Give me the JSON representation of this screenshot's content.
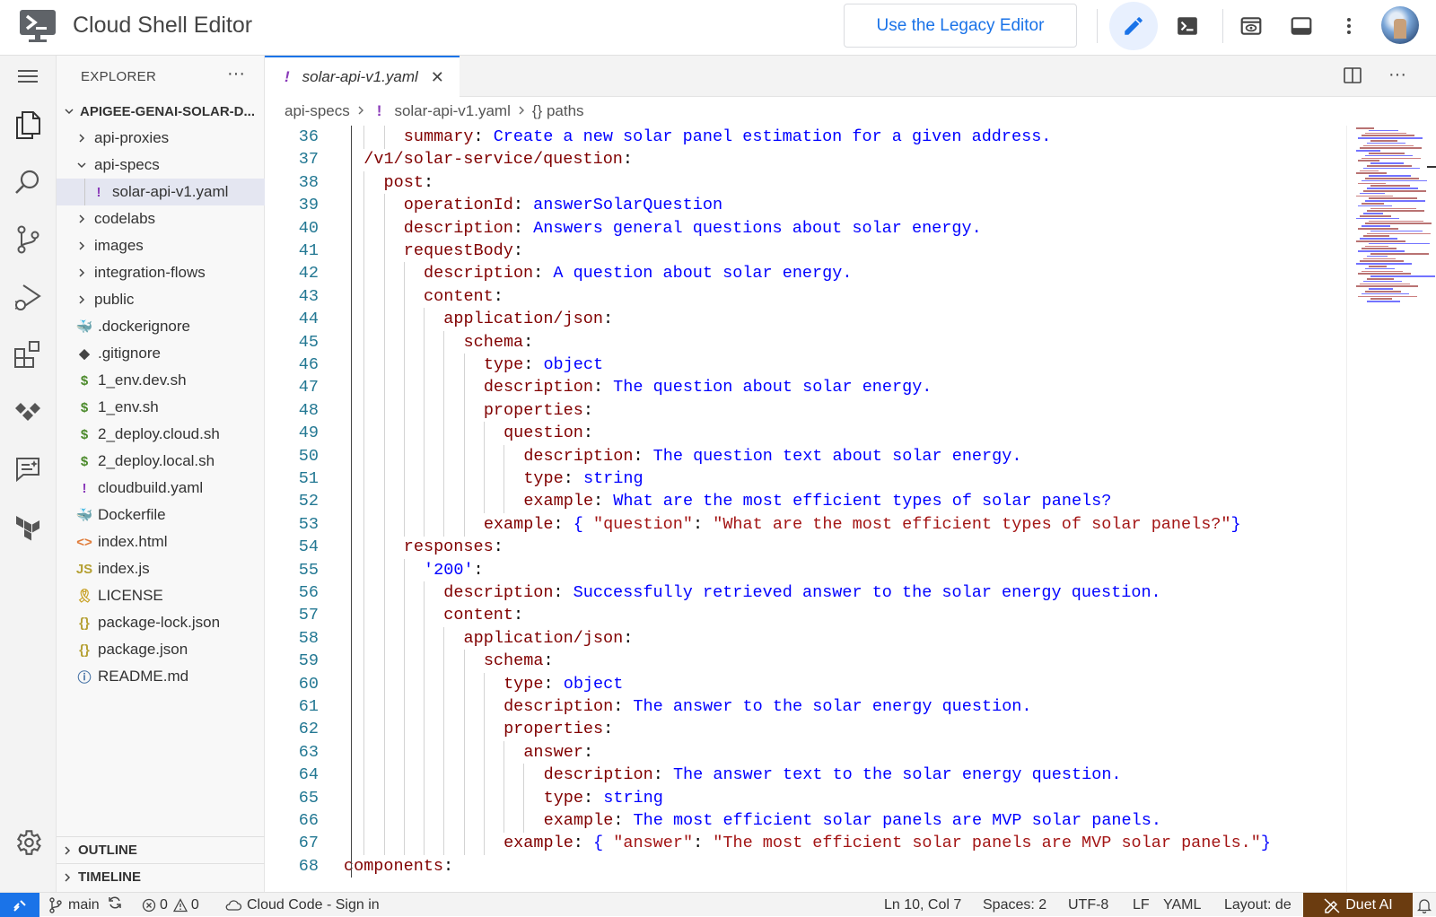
{
  "topbar": {
    "title": "Cloud Shell Editor",
    "legacy_button": "Use the Legacy Editor",
    "icons": [
      "pencil-icon",
      "terminal-icon",
      "preview-icon",
      "panel-icon",
      "more-vert-icon"
    ]
  },
  "activity_bar": [
    "menu-icon",
    "files-icon",
    "search-icon",
    "source-control-icon",
    "run-debug-icon",
    "extensions-icon",
    "cloud-code-icon",
    "duet-chat-icon",
    "terraform-icon",
    "settings-icon"
  ],
  "explorer": {
    "header": "EXPLORER",
    "more": "···",
    "root": "APIGEE-GENAI-SOLAR-D...",
    "items": [
      {
        "label": "api-proxies",
        "kind": "folder-collapsed",
        "depth": 1
      },
      {
        "label": "api-specs",
        "kind": "folder-expanded",
        "depth": 1
      },
      {
        "label": "solar-api-v1.yaml",
        "kind": "yaml",
        "depth": 2,
        "selected": true
      },
      {
        "label": "codelabs",
        "kind": "folder-collapsed",
        "depth": 1
      },
      {
        "label": "images",
        "kind": "folder-collapsed",
        "depth": 1
      },
      {
        "label": "integration-flows",
        "kind": "folder-collapsed",
        "depth": 1
      },
      {
        "label": "public",
        "kind": "folder-collapsed",
        "depth": 1
      },
      {
        "label": ".dockerignore",
        "kind": "docker",
        "depth": 1
      },
      {
        "label": ".gitignore",
        "kind": "git",
        "depth": 1
      },
      {
        "label": "1_env.dev.sh",
        "kind": "shell",
        "depth": 1
      },
      {
        "label": "1_env.sh",
        "kind": "shell",
        "depth": 1
      },
      {
        "label": "2_deploy.cloud.sh",
        "kind": "shell",
        "depth": 1
      },
      {
        "label": "2_deploy.local.sh",
        "kind": "shell",
        "depth": 1
      },
      {
        "label": "cloudbuild.yaml",
        "kind": "yaml",
        "depth": 1
      },
      {
        "label": "Dockerfile",
        "kind": "docker",
        "depth": 1
      },
      {
        "label": "index.html",
        "kind": "html",
        "depth": 1
      },
      {
        "label": "index.js",
        "kind": "js",
        "depth": 1
      },
      {
        "label": "LICENSE",
        "kind": "license",
        "depth": 1
      },
      {
        "label": "package-lock.json",
        "kind": "json",
        "depth": 1
      },
      {
        "label": "package.json",
        "kind": "json",
        "depth": 1
      },
      {
        "label": "README.md",
        "kind": "info",
        "depth": 1
      }
    ],
    "outline": "OUTLINE",
    "timeline": "TIMELINE"
  },
  "editor": {
    "tab": {
      "label": "solar-api-v1.yaml",
      "bang": "!",
      "close": "✕"
    },
    "breadcrumb": [
      "api-specs",
      "solar-api-v1.yaml",
      "{} paths"
    ],
    "lines": [
      {
        "n": "36",
        "indent": 3,
        "segs": [
          [
            "k",
            "summary"
          ],
          [
            "p",
            ": "
          ],
          [
            "s",
            "Create a new solar panel estimation for a given address."
          ]
        ]
      },
      {
        "n": "37",
        "indent": 1,
        "segs": [
          [
            "k",
            "/v1/solar-service/question"
          ],
          [
            "p",
            ":"
          ]
        ]
      },
      {
        "n": "38",
        "indent": 2,
        "segs": [
          [
            "k",
            "post"
          ],
          [
            "p",
            ":"
          ]
        ]
      },
      {
        "n": "39",
        "indent": 3,
        "segs": [
          [
            "k",
            "operationId"
          ],
          [
            "p",
            ": "
          ],
          [
            "s",
            "answerSolarQuestion"
          ]
        ]
      },
      {
        "n": "40",
        "indent": 3,
        "segs": [
          [
            "k",
            "description"
          ],
          [
            "p",
            ": "
          ],
          [
            "s",
            "Answers general questions about solar energy."
          ]
        ]
      },
      {
        "n": "41",
        "indent": 3,
        "segs": [
          [
            "k",
            "requestBody"
          ],
          [
            "p",
            ":"
          ]
        ]
      },
      {
        "n": "42",
        "indent": 4,
        "segs": [
          [
            "k",
            "description"
          ],
          [
            "p",
            ": "
          ],
          [
            "s",
            "A question about solar energy."
          ]
        ]
      },
      {
        "n": "43",
        "indent": 4,
        "segs": [
          [
            "k",
            "content"
          ],
          [
            "p",
            ":"
          ]
        ]
      },
      {
        "n": "44",
        "indent": 5,
        "segs": [
          [
            "k",
            "application/json"
          ],
          [
            "p",
            ":"
          ]
        ]
      },
      {
        "n": "45",
        "indent": 6,
        "segs": [
          [
            "k",
            "schema"
          ],
          [
            "p",
            ":"
          ]
        ]
      },
      {
        "n": "46",
        "indent": 7,
        "segs": [
          [
            "k",
            "type"
          ],
          [
            "p",
            ": "
          ],
          [
            "s",
            "object"
          ]
        ]
      },
      {
        "n": "47",
        "indent": 7,
        "segs": [
          [
            "k",
            "description"
          ],
          [
            "p",
            ": "
          ],
          [
            "s",
            "The question about solar energy."
          ]
        ]
      },
      {
        "n": "48",
        "indent": 7,
        "segs": [
          [
            "k",
            "properties"
          ],
          [
            "p",
            ":"
          ]
        ]
      },
      {
        "n": "49",
        "indent": 8,
        "segs": [
          [
            "k",
            "question"
          ],
          [
            "p",
            ":"
          ]
        ]
      },
      {
        "n": "50",
        "indent": 9,
        "segs": [
          [
            "k",
            "description"
          ],
          [
            "p",
            ": "
          ],
          [
            "s",
            "The question text about solar energy."
          ]
        ]
      },
      {
        "n": "51",
        "indent": 9,
        "segs": [
          [
            "k",
            "type"
          ],
          [
            "p",
            ": "
          ],
          [
            "s",
            "string"
          ]
        ]
      },
      {
        "n": "52",
        "indent": 9,
        "segs": [
          [
            "k",
            "example"
          ],
          [
            "p",
            ": "
          ],
          [
            "s",
            "What are the most efficient types of solar panels?"
          ]
        ]
      },
      {
        "n": "53",
        "indent": 7,
        "segs": [
          [
            "k",
            "example"
          ],
          [
            "p",
            ": "
          ],
          [
            "s",
            "{ "
          ],
          [
            "q",
            "\"question\""
          ],
          [
            "p",
            ": "
          ],
          [
            "q",
            "\"What are the most efficient types of solar panels?\""
          ],
          [
            "s",
            "}"
          ]
        ]
      },
      {
        "n": "54",
        "indent": 3,
        "segs": [
          [
            "k",
            "responses"
          ],
          [
            "p",
            ":"
          ]
        ]
      },
      {
        "n": "55",
        "indent": 4,
        "segs": [
          [
            "s",
            "'200'"
          ],
          [
            "p",
            ":"
          ]
        ]
      },
      {
        "n": "56",
        "indent": 5,
        "segs": [
          [
            "k",
            "description"
          ],
          [
            "p",
            ": "
          ],
          [
            "s",
            "Successfully retrieved answer to the solar energy question."
          ]
        ]
      },
      {
        "n": "57",
        "indent": 5,
        "segs": [
          [
            "k",
            "content"
          ],
          [
            "p",
            ":"
          ]
        ]
      },
      {
        "n": "58",
        "indent": 6,
        "segs": [
          [
            "k",
            "application/json"
          ],
          [
            "p",
            ":"
          ]
        ]
      },
      {
        "n": "59",
        "indent": 7,
        "segs": [
          [
            "k",
            "schema"
          ],
          [
            "p",
            ":"
          ]
        ]
      },
      {
        "n": "60",
        "indent": 8,
        "segs": [
          [
            "k",
            "type"
          ],
          [
            "p",
            ": "
          ],
          [
            "s",
            "object"
          ]
        ]
      },
      {
        "n": "61",
        "indent": 8,
        "segs": [
          [
            "k",
            "description"
          ],
          [
            "p",
            ": "
          ],
          [
            "s",
            "The answer to the solar energy question."
          ]
        ]
      },
      {
        "n": "62",
        "indent": 8,
        "segs": [
          [
            "k",
            "properties"
          ],
          [
            "p",
            ":"
          ]
        ]
      },
      {
        "n": "63",
        "indent": 9,
        "segs": [
          [
            "k",
            "answer"
          ],
          [
            "p",
            ":"
          ]
        ]
      },
      {
        "n": "64",
        "indent": 10,
        "segs": [
          [
            "k",
            "description"
          ],
          [
            "p",
            ": "
          ],
          [
            "s",
            "The answer text to the solar energy question."
          ]
        ]
      },
      {
        "n": "65",
        "indent": 10,
        "segs": [
          [
            "k",
            "type"
          ],
          [
            "p",
            ": "
          ],
          [
            "s",
            "string"
          ]
        ]
      },
      {
        "n": "66",
        "indent": 10,
        "segs": [
          [
            "k",
            "example"
          ],
          [
            "p",
            ": "
          ],
          [
            "s",
            "The most efficient solar panels are MVP solar panels."
          ]
        ]
      },
      {
        "n": "67",
        "indent": 8,
        "segs": [
          [
            "k",
            "example"
          ],
          [
            "p",
            ": "
          ],
          [
            "s",
            "{ "
          ],
          [
            "q",
            "\"answer\""
          ],
          [
            "p",
            ": "
          ],
          [
            "q",
            "\"The most efficient solar panels are MVP solar panels.\""
          ],
          [
            "s",
            "}"
          ]
        ]
      },
      {
        "n": "68",
        "indent": 0,
        "segs": [
          [
            "k",
            "components"
          ],
          [
            "p",
            ":"
          ]
        ]
      }
    ]
  },
  "statusbar": {
    "branch": "main",
    "errors": "0",
    "warnings": "0",
    "cloud_code": "Cloud Code - Sign in",
    "position": "Ln 10, Col 7",
    "spaces": "Spaces: 2",
    "encoding": "UTF-8",
    "eol": "LF",
    "language": "YAML",
    "layout": "Layout: de",
    "duet": "Duet AI"
  },
  "colors": {
    "accent": "#1a73e8",
    "keyword": "#800000",
    "string": "#0000ff",
    "quoted": "#a31515",
    "duet_bg": "#6b3c10"
  }
}
